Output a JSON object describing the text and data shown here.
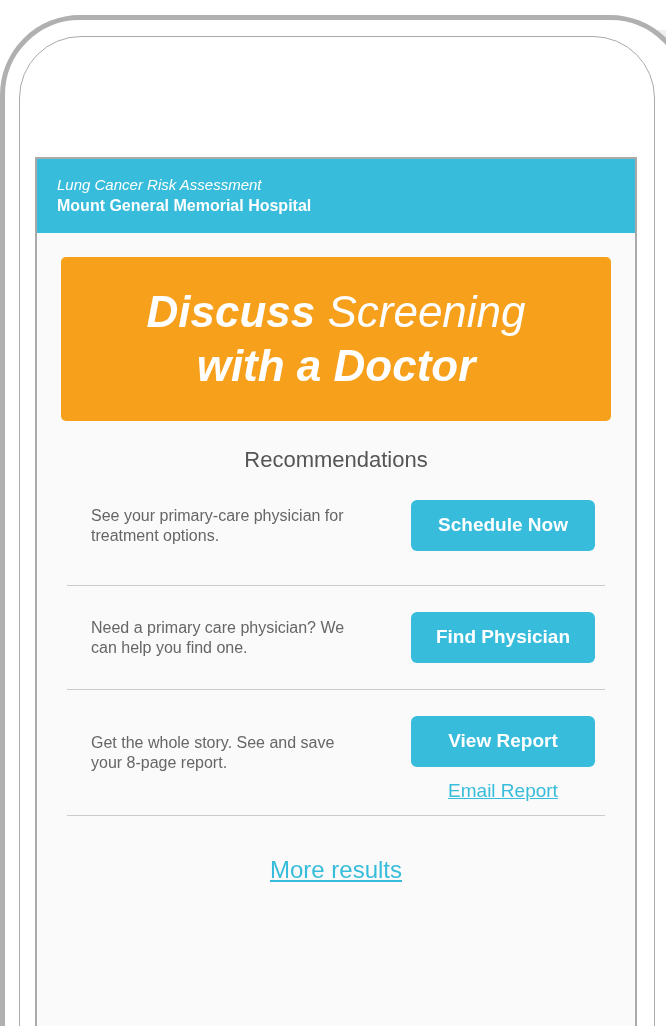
{
  "header": {
    "subtitle": "Lung Cancer Risk Assessment",
    "title": "Mount General Memorial Hospital"
  },
  "banner": {
    "headline": "**Discuss** Screening **with a Doctor**"
  },
  "recommendations": {
    "heading": "Recommendations",
    "items": [
      {
        "text": "See your primary-care physician for treatment options.",
        "button": "Schedule Now"
      },
      {
        "text": "Need a primary care physician? We can help you find one.",
        "button": "Find Physician"
      },
      {
        "text": "Get the whole story. See and save your 8-page report.",
        "button": "View Report",
        "link": "Email Report"
      }
    ]
  },
  "more_link": "More results"
}
